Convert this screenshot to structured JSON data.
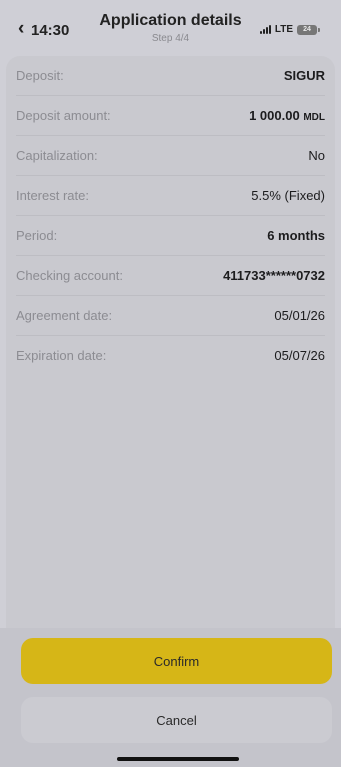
{
  "status_bar": {
    "back_glyph": "‹",
    "time": "14:30",
    "network": "LTE",
    "battery": "24"
  },
  "header": {
    "title": "Application details",
    "step": "Step 4/4"
  },
  "details": [
    {
      "label": "Deposit:",
      "value": "SIGUR"
    },
    {
      "label": "Deposit amount:",
      "value": "1 000.00",
      "unit": "MDL"
    },
    {
      "label": "Capitalization:",
      "value": "No"
    },
    {
      "label": "Interest rate:",
      "value": "5.5% (Fixed)"
    },
    {
      "label": "Period:",
      "value": "6 months"
    },
    {
      "label": "Checking account:",
      "value": "411733******0732"
    },
    {
      "label": "Agreement date:",
      "value": "05/01/26"
    },
    {
      "label": "Expiration date:",
      "value": "05/07/26"
    }
  ],
  "actions": {
    "confirm_label": "Confirm",
    "cancel_label": "Cancel"
  },
  "colors": {
    "accent": "#d6b617"
  },
  "icons": {
    "back": "chevron-left-icon",
    "signal": "signal-bars-icon",
    "battery": "battery-icon"
  }
}
